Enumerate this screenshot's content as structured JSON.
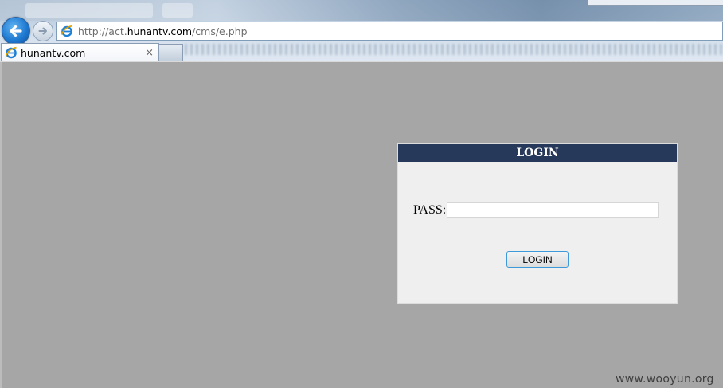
{
  "browser": {
    "url_prefix": "http://act.",
    "url_domain": "hunantv.com",
    "url_path": "/cms/e.php",
    "tab": {
      "label": "hunantv.com",
      "close_glyph": "×"
    }
  },
  "login": {
    "header": "LOGIN",
    "pass_label": "PASS:",
    "pass_value": "",
    "button_label": "LOGIN"
  },
  "watermark": "www.wooyun.org",
  "colors": {
    "page_background": "#a6a6a6",
    "panel_background": "#efefef",
    "panel_header": "#27395a",
    "button_border": "#3c9ad8"
  },
  "icons": {
    "back": "back-arrow-icon",
    "forward": "forward-arrow-icon",
    "page": "ie-logo-icon"
  }
}
